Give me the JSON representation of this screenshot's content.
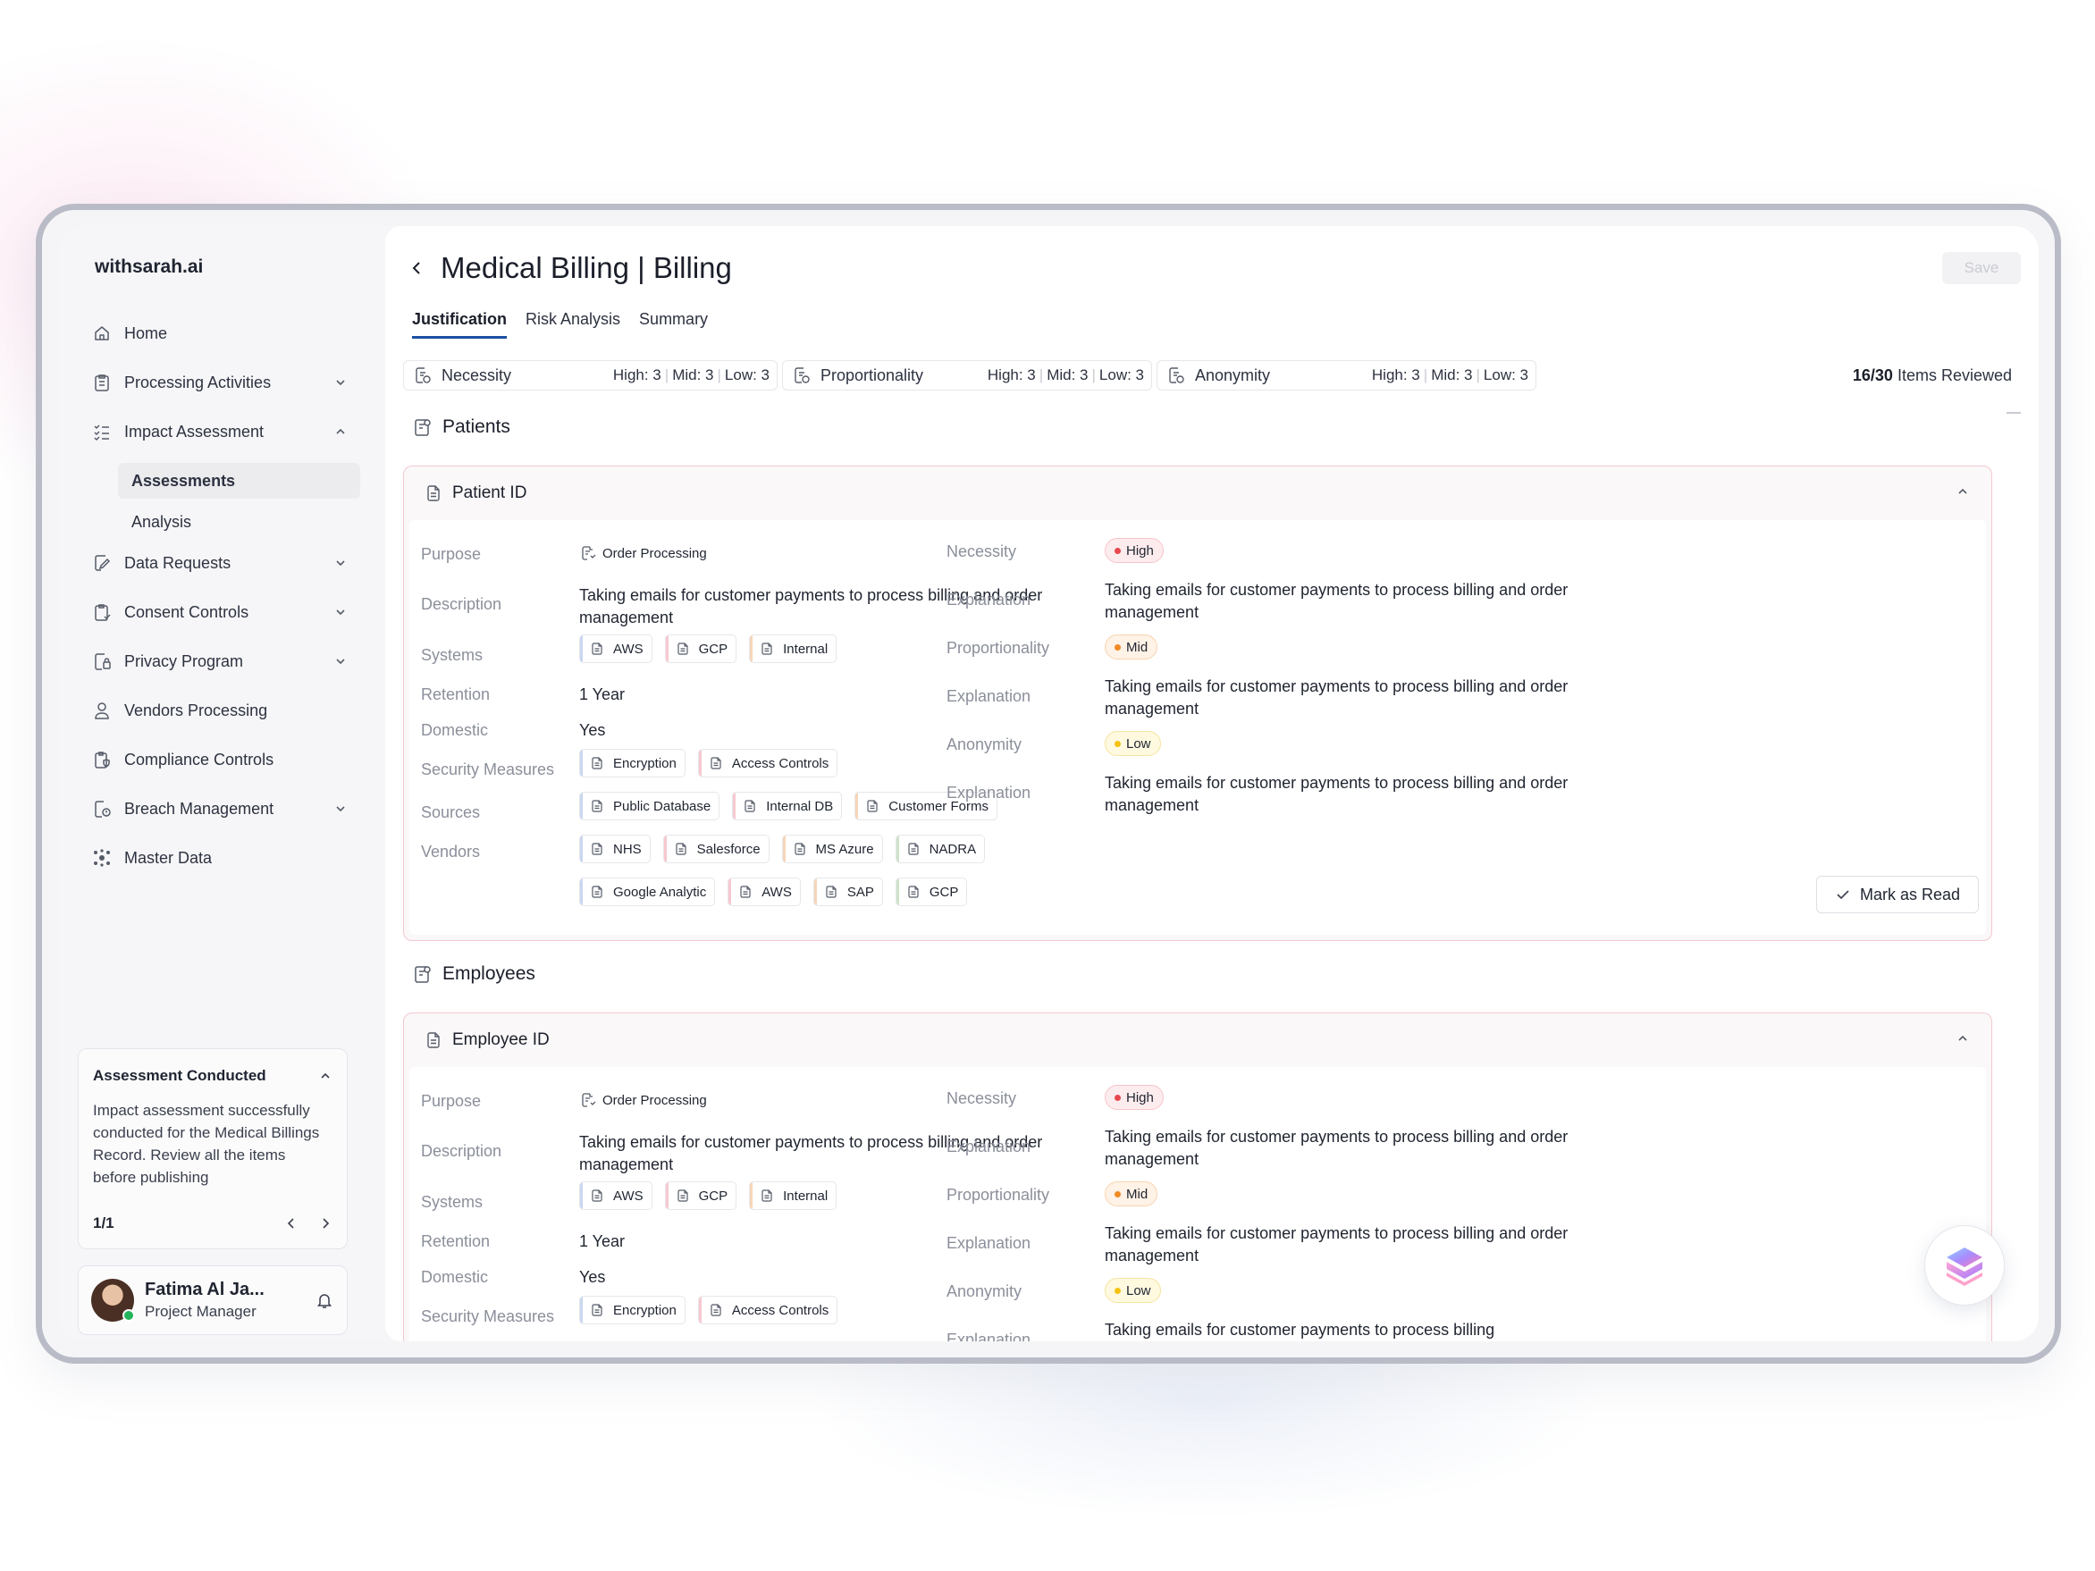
{
  "brand": "withsarah.ai",
  "sidebar": {
    "items": [
      {
        "label": "Home",
        "icon": "home-icon",
        "chevron": ""
      },
      {
        "label": "Processing Activities",
        "icon": "clipboard-list-icon",
        "chevron": "down"
      },
      {
        "label": "Impact Assessment",
        "icon": "checklist-icon",
        "chevron": "up"
      },
      {
        "label": "Data Requests",
        "icon": "edit-document-icon",
        "chevron": "down"
      },
      {
        "label": "Consent Controls",
        "icon": "clipboard-check-icon",
        "chevron": "down"
      },
      {
        "label": "Privacy Program",
        "icon": "document-lock-icon",
        "chevron": "down"
      },
      {
        "label": "Vendors Processing",
        "icon": "user-icon",
        "chevron": ""
      },
      {
        "label": "Compliance Controls",
        "icon": "clipboard-shield-icon",
        "chevron": ""
      },
      {
        "label": "Breach Management",
        "icon": "document-alert-icon",
        "chevron": "down"
      },
      {
        "label": "Master Data",
        "icon": "cube-network-icon",
        "chevron": ""
      }
    ],
    "subitems": [
      {
        "label": "Assessments",
        "active": true
      },
      {
        "label": "Analysis",
        "active": false
      }
    ]
  },
  "notice": {
    "title": "Assessment Conducted",
    "body": "Impact assessment successfully conducted for the Medical Billings Record. Review all the items before publishing",
    "pager": "1/1"
  },
  "user": {
    "name": "Fatima Al Ja...",
    "role": "Project Manager"
  },
  "header": {
    "title": "Medical Billing | Billing",
    "save_label": "Save"
  },
  "tabs": [
    {
      "label": "Justification",
      "active": true
    },
    {
      "label": "Risk Analysis",
      "active": false
    },
    {
      "label": "Summary",
      "active": false
    }
  ],
  "stats": [
    {
      "name": "Necessity",
      "high": "High: 3",
      "mid": "Mid: 3",
      "low": "Low: 3"
    },
    {
      "name": "Proportionality",
      "high": "High: 3",
      "mid": "Mid: 3",
      "low": "Low: 3"
    },
    {
      "name": "Anonymity",
      "high": "High: 3",
      "mid": "Mid: 3",
      "low": "Low: 3"
    }
  ],
  "reviewed": {
    "count": "16/30",
    "label": "Items Reviewed"
  },
  "labels": {
    "purpose": "Purpose",
    "description": "Description",
    "systems": "Systems",
    "retention": "Retention",
    "domestic": "Domestic",
    "security": "Security Measures",
    "sources": "Sources",
    "vendors": "Vendors",
    "necessity": "Necessity",
    "explanation": "Explanation",
    "proportionality": "Proportionality",
    "anonymity": "Anonymity"
  },
  "sections": [
    {
      "title": "Patients",
      "card": {
        "title": "Patient ID",
        "purpose": "Order Processing",
        "description": "Taking emails for customer payments to process billing and order management",
        "systems": [
          "AWS",
          "GCP",
          "Internal"
        ],
        "retention": "1 Year",
        "domestic": "Yes",
        "security": [
          "Encryption",
          "Access Controls"
        ],
        "sources": [
          "Public Database",
          "Internal DB",
          "Customer Forms"
        ],
        "vendors_row1": [
          "NHS",
          "Salesforce",
          "MS Azure",
          "NADRA"
        ],
        "vendors_row2": [
          "Google Analytic",
          "AWS",
          "SAP",
          "GCP"
        ],
        "necessity": "High",
        "necessity_expl": "Taking emails for customer payments to process billing and order management",
        "proportionality": "Mid",
        "proportionality_expl": "Taking emails for customer payments to process billing and order management",
        "anonymity": "Low",
        "anonymity_expl": "Taking emails for customer payments to process billing and order management",
        "mark_label": "Mark as Read"
      }
    },
    {
      "title": "Employees",
      "card": {
        "title": "Employee ID",
        "purpose": "Order Processing",
        "description": "Taking emails for customer payments to process billing and order management",
        "systems": [
          "AWS",
          "GCP",
          "Internal"
        ],
        "retention": "1 Year",
        "domestic": "Yes",
        "security": [
          "Encryption",
          "Access Controls"
        ],
        "necessity": "High",
        "necessity_expl": "Taking emails for customer payments to process billing and order management",
        "proportionality": "Mid",
        "proportionality_expl": "Taking emails for customer payments to process billing and order management",
        "anonymity": "Low",
        "anonymity_expl": "Taking emails for customer payments to process billing"
      }
    }
  ],
  "colors": {
    "high": "#e5484d",
    "high_bg": "#fdecee",
    "high_border": "#f6c5ca",
    "mid": "#f08a24",
    "mid_bg": "#fff2e6",
    "mid_border": "#f8d4b0",
    "low": "#f5c211",
    "low_bg": "#fff9e0",
    "low_border": "#f5e4a0",
    "accent": "#1b4fa3",
    "chip_bars": [
      "#c9d7f0",
      "#f6c9d0",
      "#f6d6b8",
      "#cfe3c9"
    ]
  }
}
